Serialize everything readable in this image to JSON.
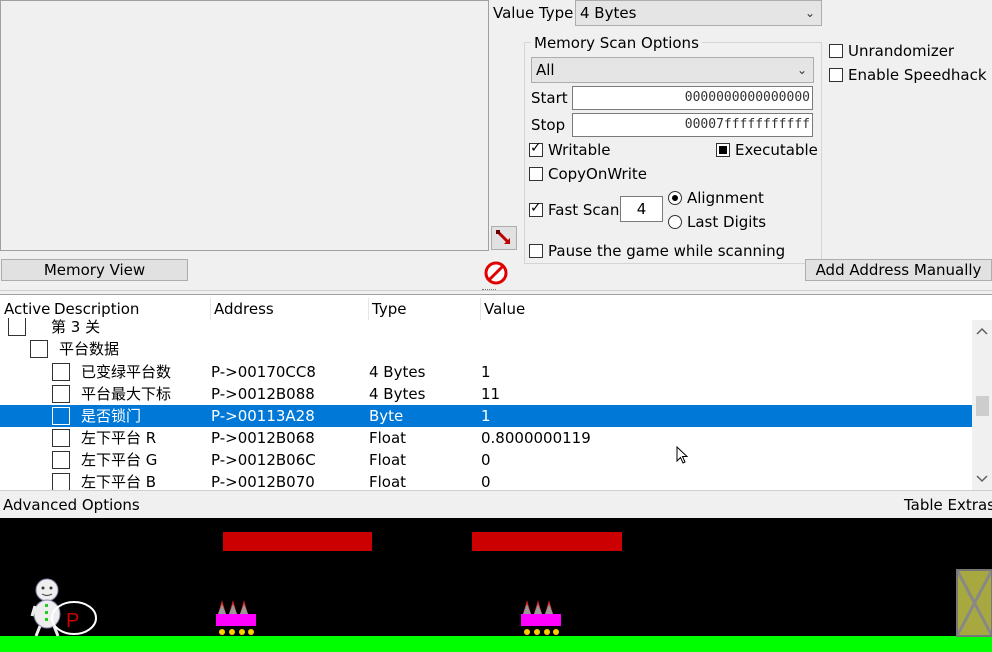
{
  "scan": {
    "value_type_label": "Value Type",
    "value_type": "4 Bytes",
    "memory_scan_options_label": "Memory Scan Options",
    "region": "All",
    "start_label": "Start",
    "start_value": "0000000000000000",
    "stop_label": "Stop",
    "stop_value": "00007fffffffffff",
    "writable_label": "Writable",
    "executable_label": "Executable",
    "copyonwrite_label": "CopyOnWrite",
    "fast_scan_label": "Fast Scan",
    "fast_scan_value": "4",
    "alignment_label": "Alignment",
    "last_digits_label": "Last Digits",
    "pause_label": "Pause the game while scanning",
    "unrandomizer_label": "Unrandomizer",
    "speedhack_label": "Enable Speedhack"
  },
  "buttons": {
    "memory_view": "Memory View",
    "add_address": "Add Address Manually",
    "advanced_options": "Advanced Options",
    "table_extras": "Table Extras"
  },
  "table": {
    "headers": {
      "active": "Active",
      "description": "Description",
      "address": "Address",
      "type": "Type",
      "value": "Value"
    },
    "rows": [
      {
        "description": "第 3 关",
        "address": "",
        "type": "",
        "value": ""
      },
      {
        "description": "平台数据",
        "address": "",
        "type": "",
        "value": ""
      },
      {
        "description": "已变绿平台数",
        "address": "P->00170CC8",
        "type": "4 Bytes",
        "value": "1"
      },
      {
        "description": "平台最大下标",
        "address": "P->0012B088",
        "type": "4 Bytes",
        "value": "11"
      },
      {
        "description": "是否锁门",
        "address": "P->00113A28",
        "type": "Byte",
        "value": "1"
      },
      {
        "description": "左下平台 R",
        "address": "P->0012B068",
        "type": "Float",
        "value": "0.8000000119"
      },
      {
        "description": "左下平台 G",
        "address": "P->0012B06C",
        "type": "Float",
        "value": "0"
      },
      {
        "description": "左下平台 B",
        "address": "P->0012B070",
        "type": "Float",
        "value": "0"
      }
    ]
  },
  "game": {
    "player_letter": "P"
  },
  "colors": {
    "selection": "#0078d7",
    "platform_red": "#cc0000",
    "ground_green": "#00ff00",
    "trap_magenta": "#ff00ff"
  }
}
